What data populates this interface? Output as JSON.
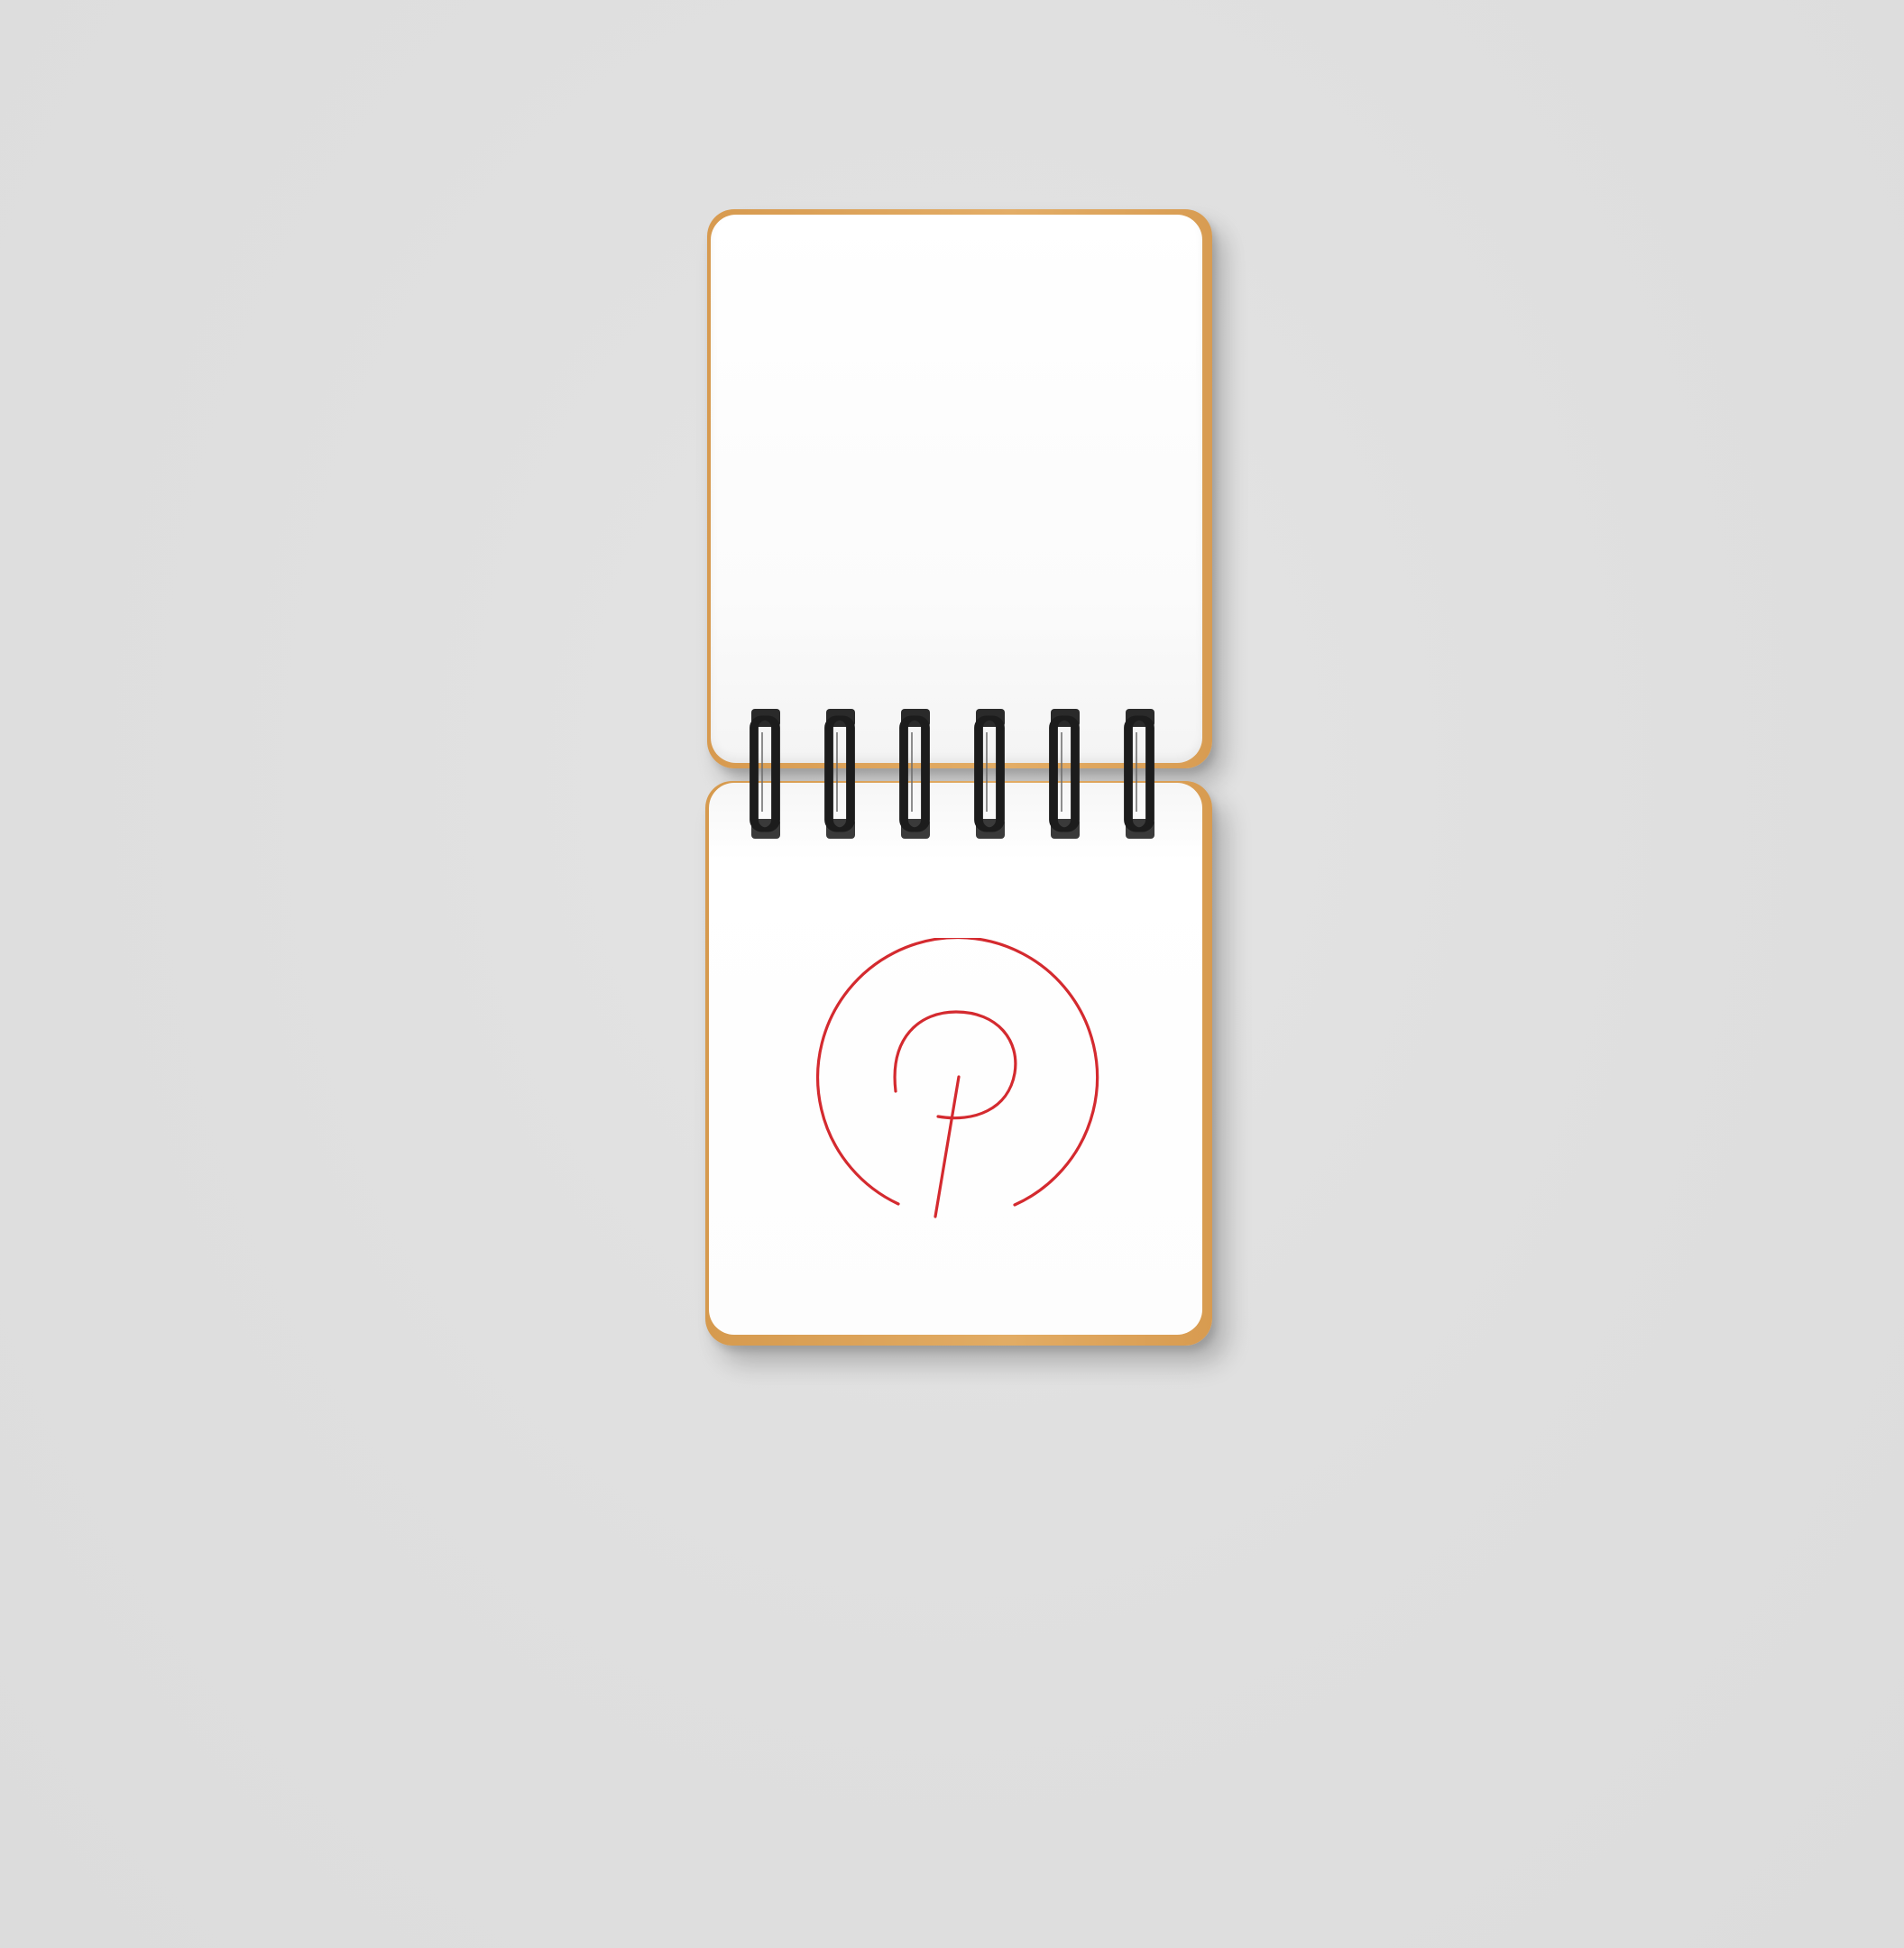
{
  "scene": {
    "background_color": "#e0e0e0",
    "subject": "spiral-notebook",
    "cover_edge_color": "#e0a85f",
    "page_color": "#ffffff",
    "spiral_color": "#1c1c1c",
    "spiral_ring_count": 6
  },
  "logo": {
    "icon": "p-circle-logo",
    "stroke_color": "#d42a2f"
  }
}
